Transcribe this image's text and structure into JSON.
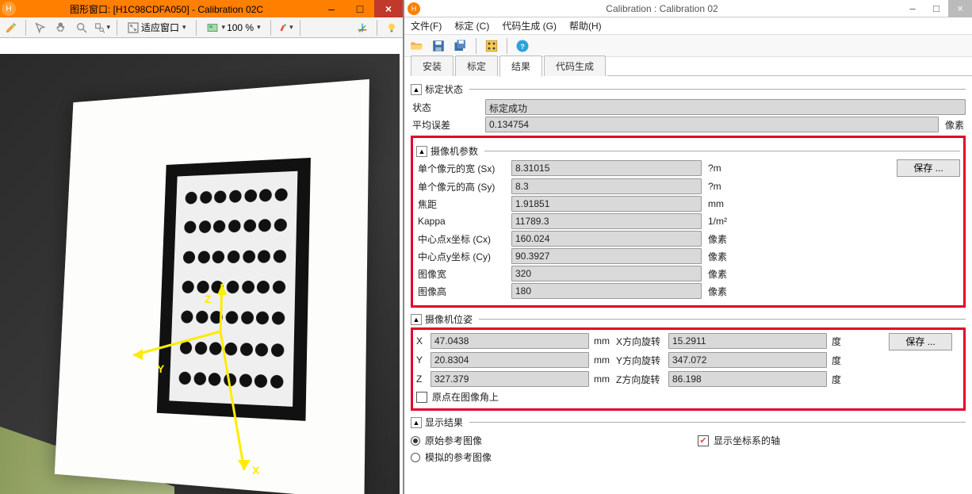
{
  "left_window": {
    "title": "图形窗口: [H1C98CDFA050] - Calibration 02C",
    "fit_label": "适应窗口",
    "zoom_label": "100 %"
  },
  "right_window": {
    "title": "Calibration : Calibration 02"
  },
  "menu": {
    "file": "文件(F)",
    "calib": "标定 (C)",
    "codegen": "代码生成 (G)",
    "help": "帮助(H)"
  },
  "tabs": {
    "install": "安装",
    "calib": "标定",
    "result": "结果",
    "codegen": "代码生成"
  },
  "status_section": {
    "title": "标定状态",
    "state_label": "状态",
    "state_value": "标定成功",
    "err_label": "平均误差",
    "err_value": "0.134754",
    "err_unit": "像素"
  },
  "camera_section": {
    "title": "摄像机参数",
    "save_btn": "保存 ...",
    "rows": [
      {
        "label": "单个像元的宽 (Sx)",
        "value": "8.31015",
        "unit": "?m"
      },
      {
        "label": "单个像元的高 (Sy)",
        "value": "8.3",
        "unit": "?m"
      },
      {
        "label": "焦距",
        "value": "1.91851",
        "unit": "mm"
      },
      {
        "label": "Kappa",
        "value": "11789.3",
        "unit": "1/m²"
      },
      {
        "label": "中心点x坐标 (Cx)",
        "value": "160.024",
        "unit": "像素"
      },
      {
        "label": "中心点y坐标 (Cy)",
        "value": "90.3927",
        "unit": "像素"
      },
      {
        "label": "图像宽",
        "value": "320",
        "unit": "像素"
      },
      {
        "label": "图像高",
        "value": "180",
        "unit": "像素"
      }
    ]
  },
  "pose_section": {
    "title": "摄像机位姿",
    "save_btn": "保存 ...",
    "rows": [
      {
        "l1": "X",
        "v1": "47.0438",
        "u1": "mm",
        "l2": "X方向旋转",
        "v2": "15.2911",
        "u2": "度"
      },
      {
        "l1": "Y",
        "v1": "20.8304",
        "u1": "mm",
        "l2": "Y方向旋转",
        "v2": "347.072",
        "u2": "度"
      },
      {
        "l1": "Z",
        "v1": "327.379",
        "u1": "mm",
        "l2": "Z方向旋转",
        "v2": "86.198",
        "u2": "度"
      }
    ],
    "origin_label": "原点在图像角上"
  },
  "display_section": {
    "title": "显示结果",
    "opt_orig": "原始参考图像",
    "opt_sim": "模拟的参考图像",
    "axis_label": "显示坐标系的轴"
  }
}
